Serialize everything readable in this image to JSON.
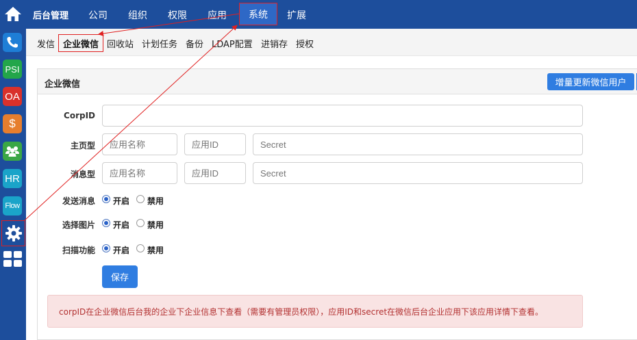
{
  "sidebar": {
    "items": [
      {
        "icon": "home-icon"
      },
      {
        "icon": "phone-icon"
      },
      {
        "label": "PSI"
      },
      {
        "label": "OA"
      },
      {
        "label": "$"
      },
      {
        "icon": "users-icon"
      },
      {
        "label": "HR"
      },
      {
        "label": "Flow"
      },
      {
        "icon": "gear-icon"
      },
      {
        "icon": "grid-icon"
      }
    ]
  },
  "topbar": {
    "brand": "后台管理",
    "nav": [
      "公司",
      "组织",
      "权限",
      "应用",
      "系统",
      "扩展"
    ],
    "active": "系统"
  },
  "subnav": {
    "items": [
      "发信",
      "企业微信",
      "回收站",
      "计划任务",
      "备份",
      "LDAP配置",
      "进销存",
      "授权"
    ],
    "active": "企业微信"
  },
  "panel": {
    "title": "企业微信",
    "sync_button": "增量更新微信用户"
  },
  "form": {
    "corpid_label": "CorpID",
    "corpid_value": "",
    "main_label": "主页型",
    "main_app_name_placeholder": "应用名称",
    "main_app_id_placeholder": "应用ID",
    "main_secret_placeholder": "Secret",
    "msg_label": "消息型",
    "msg_app_name_placeholder": "应用名称",
    "msg_app_id_placeholder": "应用ID",
    "msg_secret_placeholder": "Secret",
    "send_label": "发送消息",
    "image_label": "选择图片",
    "scan_label": "扫描功能",
    "on_label": "开启",
    "off_label": "禁用",
    "send_value": "开启",
    "image_value": "开启",
    "scan_value": "开启",
    "save_button": "保存"
  },
  "note": "corpID在企业微信后台我的企业下企业信息下查看（需要有管理员权限），应用ID和secret在微信后台企业应用下该应用详情下查看。",
  "colors": {
    "nav_bg": "#1d4e9c",
    "primary": "#2f7de1",
    "highlight": "#e02020",
    "note_bg": "#f9e3e3",
    "note_text": "#b23030"
  }
}
